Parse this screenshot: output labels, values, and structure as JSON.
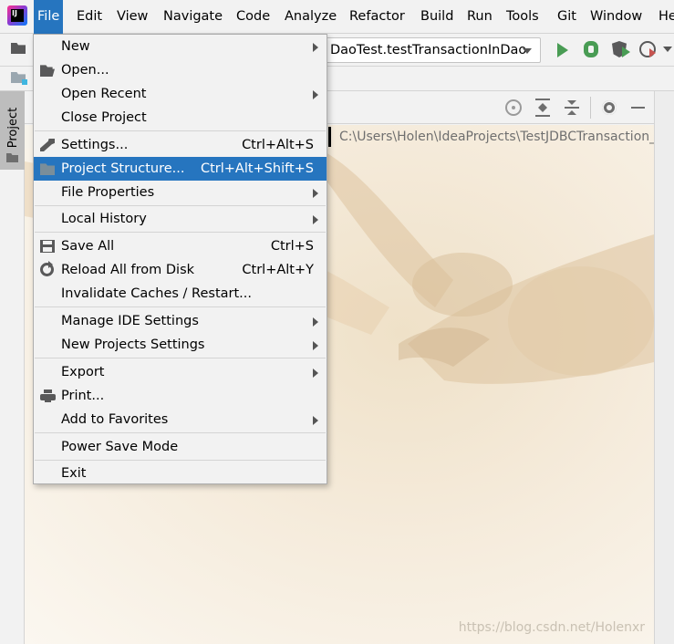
{
  "menubar": {
    "items": [
      {
        "label": "File",
        "active": true
      },
      {
        "label": "Edit"
      },
      {
        "label": "View"
      },
      {
        "label": "Navigate"
      },
      {
        "label": "Code"
      },
      {
        "label": "Analyze"
      },
      {
        "label": "Refactor"
      },
      {
        "label": "Build"
      },
      {
        "label": "Run"
      },
      {
        "label": "Tools"
      },
      {
        "label": "Git"
      },
      {
        "label": "Window"
      },
      {
        "label": "He"
      }
    ]
  },
  "toolbar": {
    "run_config": "DaoTest.testTransactionInDao"
  },
  "left_strip": {
    "project_tab": "Project"
  },
  "content": {
    "path": "C:\\Users\\Holen\\IdeaProjects\\TestJDBCTransaction_d",
    "watermark": "https://blog.csdn.net/Holenxr"
  },
  "file_menu": {
    "items": [
      {
        "label": "New",
        "submenu": true
      },
      {
        "label": "Open...",
        "icon": "folder-open-icon"
      },
      {
        "label": "Open Recent",
        "submenu": true
      },
      {
        "label": "Close Project"
      },
      {
        "label": "Settings...",
        "shortcut": "Ctrl+Alt+S",
        "icon": "wrench-icon"
      },
      {
        "label": "Project Structure...",
        "shortcut": "Ctrl+Alt+Shift+S",
        "icon": "project-structure-icon",
        "highlighted": true
      },
      {
        "label": "File Properties",
        "submenu": true
      },
      {
        "label": "Local History",
        "submenu": true
      },
      {
        "label": "Save All",
        "shortcut": "Ctrl+S",
        "icon": "save-icon"
      },
      {
        "label": "Reload All from Disk",
        "shortcut": "Ctrl+Alt+Y",
        "icon": "reload-icon"
      },
      {
        "label": "Invalidate Caches / Restart..."
      },
      {
        "label": "Manage IDE Settings",
        "submenu": true
      },
      {
        "label": "New Projects Settings",
        "submenu": true
      },
      {
        "label": "Export",
        "submenu": true
      },
      {
        "label": "Print...",
        "icon": "print-icon"
      },
      {
        "label": "Add to Favorites",
        "submenu": true
      },
      {
        "label": "Power Save Mode"
      },
      {
        "label": "Exit"
      }
    ]
  },
  "colors": {
    "accent": "#2675bf",
    "run": "#499c54",
    "menu_bg": "#f2f2f2"
  }
}
